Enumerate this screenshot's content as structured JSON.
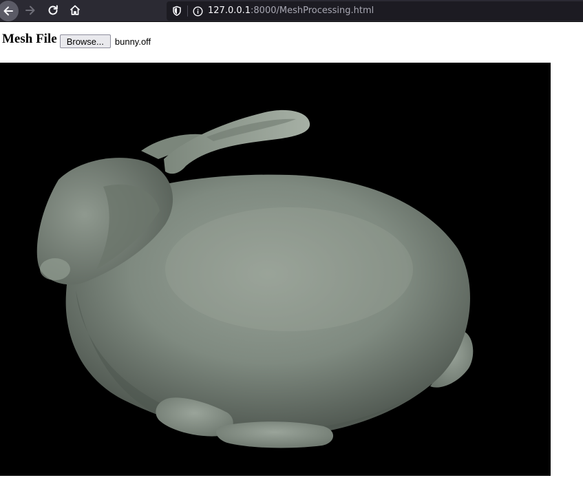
{
  "browser": {
    "url_host": "127.0.0.1",
    "url_rest": ":8000/MeshProcessing.html",
    "icons": {
      "back": "back-arrow-icon",
      "forward": "forward-arrow-icon",
      "reload": "reload-icon",
      "home": "home-icon",
      "tracking": "shield-icon",
      "site_info": "info-icon"
    }
  },
  "page": {
    "mesh_label": "Mesh File",
    "browse_label": "Browse...",
    "file_name": "bunny.off"
  },
  "colors": {
    "chrome_bg": "#2b2a33",
    "urlbar_bg": "#1c1b22",
    "canvas_bg": "#000000",
    "mesh_color": "#8c978c"
  }
}
